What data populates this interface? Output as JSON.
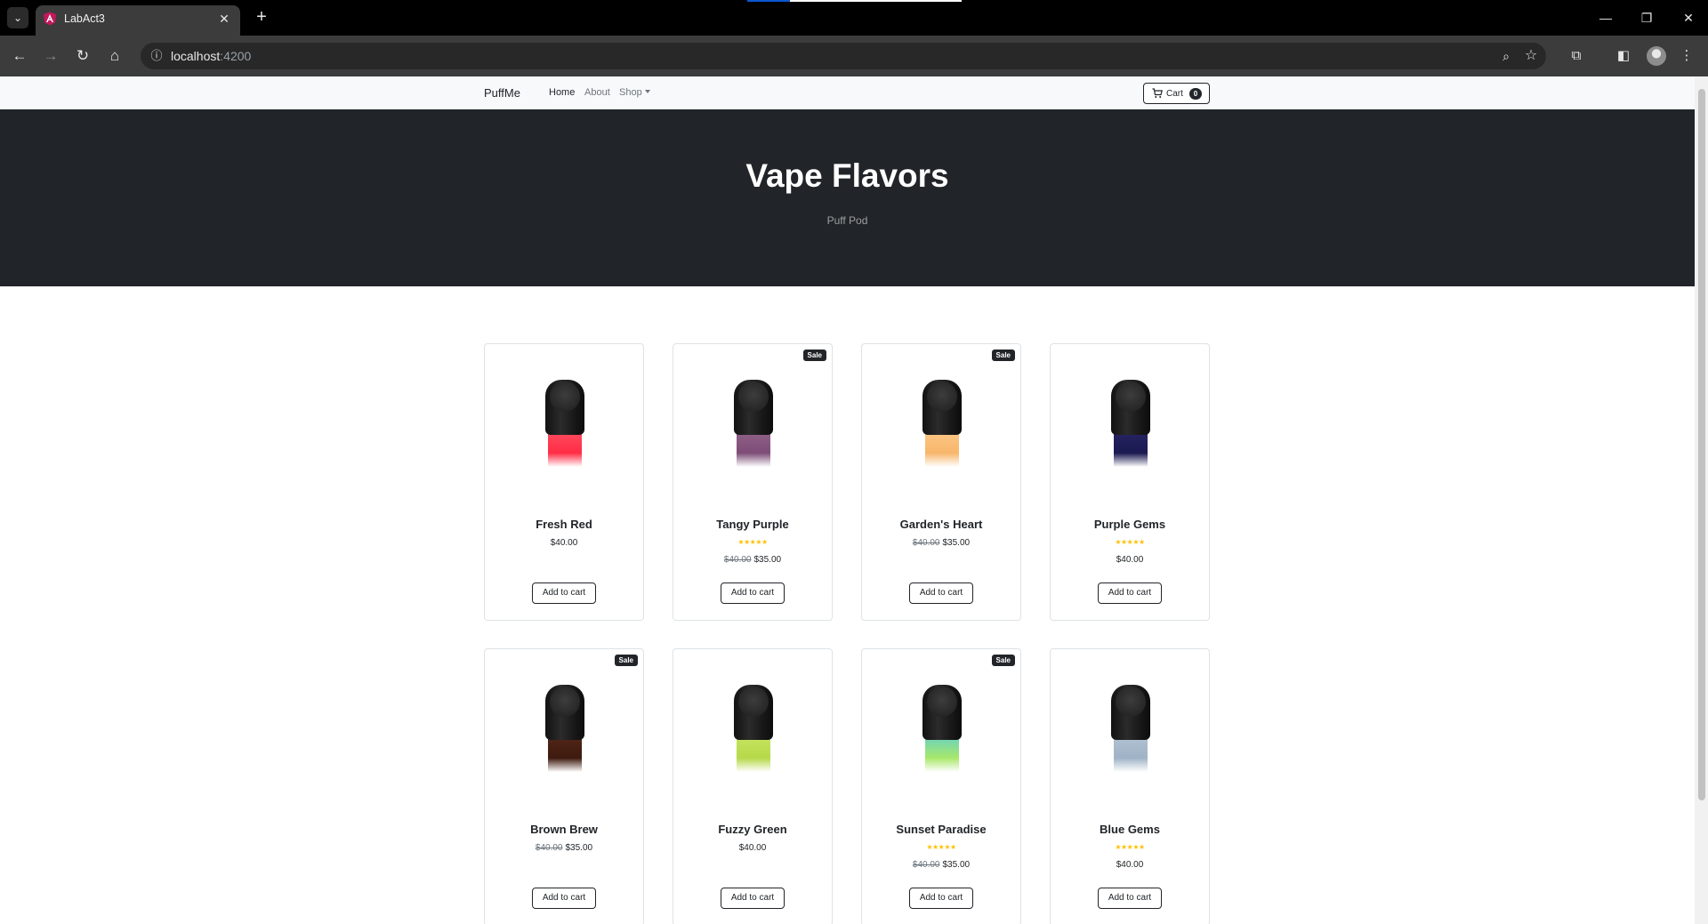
{
  "browser": {
    "tab_title": "LabAct3",
    "url_host": "localhost",
    "url_port": ":4200"
  },
  "navbar": {
    "brand": "PuffMe",
    "links": [
      "Home",
      "About",
      "Shop"
    ],
    "cart_label": "Cart",
    "cart_count": "0"
  },
  "header": {
    "title": "Vape Flavors",
    "subtitle": "Puff Pod"
  },
  "products": [
    {
      "name": "Fresh Red",
      "sale": false,
      "rated": false,
      "old_price": "",
      "price": "$40.00",
      "color_top": "#ff5a6e",
      "color_bottom": "#ff2d45"
    },
    {
      "name": "Tangy Purple",
      "sale": true,
      "rated": true,
      "old_price": "$40.00",
      "price": "$35.00",
      "color_top": "#9b6b93",
      "color_bottom": "#7d4d77"
    },
    {
      "name": "Garden's Heart",
      "sale": true,
      "rated": false,
      "old_price": "$40.00",
      "price": "$35.00",
      "color_top": "#ffd092",
      "color_bottom": "#f7b66b"
    },
    {
      "name": "Purple Gems",
      "sale": false,
      "rated": true,
      "old_price": "",
      "price": "$40.00",
      "color_top": "#2c2a6b",
      "color_bottom": "#1b1950"
    },
    {
      "name": "Brown Brew",
      "sale": true,
      "rated": false,
      "old_price": "$40.00",
      "price": "$35.00",
      "color_top": "#5a2c1c",
      "color_bottom": "#3e1a0f"
    },
    {
      "name": "Fuzzy Green",
      "sale": false,
      "rated": false,
      "old_price": "",
      "price": "$40.00",
      "color_top": "#cdea6a",
      "color_bottom": "#b6d94a"
    },
    {
      "name": "Sunset Paradise",
      "sale": true,
      "rated": true,
      "old_price": "$40.00",
      "price": "$35.00",
      "color_top": "#4cc8e8",
      "color_bottom": "#a8e86a"
    },
    {
      "name": "Blue Gems",
      "sale": false,
      "rated": true,
      "old_price": "",
      "price": "$40.00",
      "color_top": "#b9c9d8",
      "color_bottom": "#9fb3c6"
    }
  ],
  "labels": {
    "sale_badge": "Sale",
    "add_to_cart": "Add to cart",
    "stars": "★★★★★"
  },
  "colors": {
    "dark": "#212529",
    "navbar_bg": "#f8f9fa",
    "star": "#ffc107"
  }
}
